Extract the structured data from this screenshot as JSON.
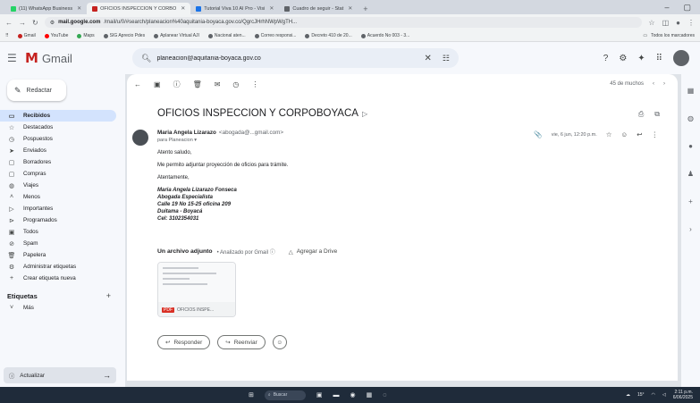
{
  "browser": {
    "tabs": [
      {
        "title": "(11) WhatsApp Business",
        "active": false
      },
      {
        "title": "OFICIOS INSPECCION Y CORBO",
        "active": true
      },
      {
        "title": "Tutorial Viva 10 AI Pro - Visi",
        "active": false
      },
      {
        "title": "Cuadro de seguir - Stat",
        "active": false
      }
    ],
    "url_host": "mail.google.com",
    "url_path": "/mail/u/0/#search/planeacion%40aquitania-boyaca.gov.co/QgrcJHrhNWpWgTH...",
    "bookmarks": [
      "Gmail",
      "YouTube",
      "Maps",
      "SIG Aprecio Pdes",
      "Aplanear Virtual AJI",
      "Nacional aten...",
      "Correo responsi...",
      "Decreto 410 de 20...",
      "Acuerdo No 003 - 3..."
    ],
    "bookmarks_all": "Todos los marcadores"
  },
  "gmail": {
    "app_name": "Gmail",
    "search_query": "planeacion@aquitania-boyaca.gov.co",
    "compose_label": "Redactar",
    "nav": [
      {
        "label": "Recibidos",
        "icon": "inbox-icon",
        "glyph": "▭",
        "active": true
      },
      {
        "label": "Destacados",
        "icon": "star-icon",
        "glyph": "☆",
        "active": false
      },
      {
        "label": "Pospuestos",
        "icon": "clock-icon",
        "glyph": "◷",
        "active": false
      },
      {
        "label": "Enviados",
        "icon": "send-icon",
        "glyph": "➤",
        "active": false
      },
      {
        "label": "Borradores",
        "icon": "draft-icon",
        "glyph": "▢",
        "active": false
      },
      {
        "label": "Compras",
        "icon": "shopping-icon",
        "glyph": "▢",
        "active": false
      },
      {
        "label": "Viajes",
        "icon": "travel-icon",
        "glyph": "◍",
        "active": false
      },
      {
        "label": "Menos",
        "icon": "chevron-up-icon",
        "glyph": "˄",
        "active": false
      },
      {
        "label": "Importantes",
        "icon": "important-icon",
        "glyph": "▷",
        "active": false
      },
      {
        "label": "Programados",
        "icon": "scheduled-icon",
        "glyph": "⊳",
        "active": false
      },
      {
        "label": "Todos",
        "icon": "all-mail-icon",
        "glyph": "▣",
        "active": false
      },
      {
        "label": "Spam",
        "icon": "spam-icon",
        "glyph": "⊘",
        "active": false
      },
      {
        "label": "Papelera",
        "icon": "trash-icon",
        "glyph": "🗑",
        "active": false
      },
      {
        "label": "Administrar etiquetas",
        "icon": "gear-icon",
        "glyph": "⚙",
        "active": false
      },
      {
        "label": "Crear etiqueta nueva",
        "icon": "plus-icon",
        "glyph": "+",
        "active": false
      }
    ],
    "labels_heading": "Etiquetas",
    "labels_more": "Más",
    "refresh_label": "Actualizar",
    "pager_text": "45 de muchos"
  },
  "message": {
    "subject": "OFICIOS INSPECCION Y CORPOBOYACA",
    "sender_name": "Maria Angela Lizarazo",
    "sender_email": "<abogada@...gmail.com>",
    "to_line": "para Planeacion ▾",
    "date": "vie, 6 jun, 12:20 p.m.",
    "greeting": "Atento saludo,",
    "body_line": "Me permito adjuntar proyección de oficios para trámite.",
    "closing": "Atentamente,",
    "signature": [
      "Maria Angela Lizarazo Fonseca",
      "Abogada Especialista",
      "Calle 19 No 15-25 oficina 209",
      "Duitama - Boyacá",
      "Cel: 3102354031"
    ],
    "attachment_heading": "Un archivo adjunto",
    "scan_text": "• Analizado por Gmail ⓘ",
    "drive_label": "Agregar a Drive",
    "attachment_name": "OFICIOS INSPE...",
    "attachment_type": "PDF",
    "reply_label": "Responder",
    "forward_label": "Reenviar"
  },
  "taskbar": {
    "search_placeholder": "Buscar",
    "time": "2:11 p.m.",
    "date": "6/06/2025",
    "weather": "15°"
  }
}
